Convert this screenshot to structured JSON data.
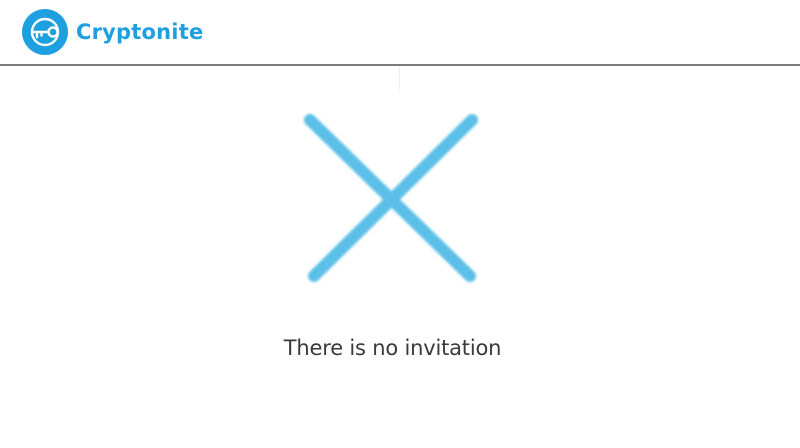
{
  "app": {
    "brand_name": "Cryptonite",
    "logo_icon": "key-circle-icon"
  },
  "main": {
    "status_icon": "close-x-icon",
    "message": "There is no invitation"
  },
  "colors": {
    "brand": "#1ea0e0",
    "icon": "#5bbfe8",
    "message_text": "#3a3a3a",
    "divider": "#7d7d7d"
  }
}
